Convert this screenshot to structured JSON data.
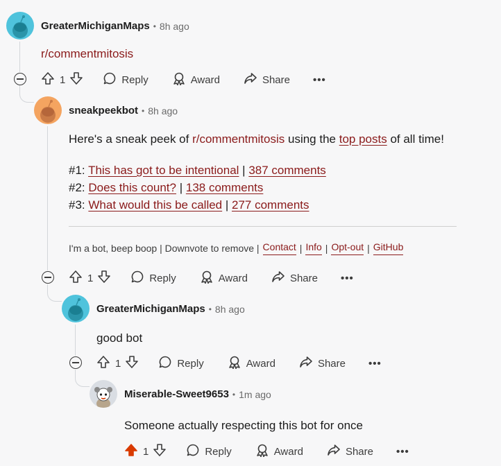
{
  "comments": [
    {
      "username": "GreaterMichiganMaps",
      "time": "8h ago",
      "body": "r/commentmitosis",
      "votes": "1",
      "vote_state": "none",
      "avatar_color": "#4fc3dc"
    },
    {
      "username": "sneakpeekbot",
      "time": "8h ago",
      "intro": {
        "pre": "Here's a sneak peek of ",
        "sub_link": "r/commentmitosis",
        "mid": " using the ",
        "top_link": "top posts",
        "post": " of all time!"
      },
      "posts": [
        {
          "prefix": "#1: ",
          "title": "This has got to be intentional",
          "sep": " | ",
          "comments": "387 comments"
        },
        {
          "prefix": "#2: ",
          "title": "Does this count?",
          "sep": " | ",
          "comments": "138 comments"
        },
        {
          "prefix": "#3: ",
          "title": "What would this be called",
          "sep": " | ",
          "comments": "277 comments"
        }
      ],
      "footer": {
        "text": "I'm a bot, beep boop | Downvote to remove |",
        "links": [
          "Contact",
          "Info",
          "Opt-out",
          "GitHub"
        ]
      },
      "votes": "1",
      "vote_state": "none",
      "avatar_color": "#f4a460"
    },
    {
      "username": "GreaterMichiganMaps",
      "time": "8h ago",
      "body": "good bot",
      "votes": "1",
      "vote_state": "none",
      "avatar_color": "#4fc3dc"
    },
    {
      "username": "Miserable-Sweet9653",
      "time": "1m ago",
      "body": "Someone actually respecting this bot for once",
      "votes": "1",
      "vote_state": "upvoted",
      "avatar_color": "#d9dde3"
    }
  ],
  "actions": {
    "reply": "Reply",
    "award": "Award",
    "share": "Share",
    "more": "•••",
    "header_dot": "•"
  },
  "colors": {
    "link": "#8a1a1a",
    "upvote_active": "#d93a00",
    "thread_line": "#d3d6da",
    "background": "#f7f7f8"
  }
}
